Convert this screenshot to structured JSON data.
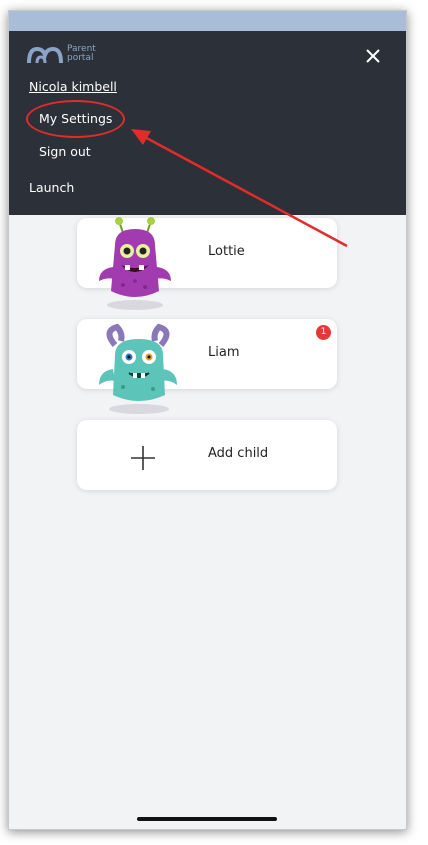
{
  "app": {
    "brand_line1": "Parent",
    "brand_line2": "portal"
  },
  "menu": {
    "user_name": "Nicola kimbell",
    "items": [
      {
        "label": "My Settings"
      },
      {
        "label": "Sign out"
      }
    ],
    "launch_label": "Launch"
  },
  "children": [
    {
      "name": "Lottie",
      "avatar_icon": "purple-monster-icon"
    },
    {
      "name": "Liam",
      "avatar_icon": "teal-monster-icon",
      "badge": "1"
    }
  ],
  "add_child_label": "Add child",
  "colors": {
    "menu_bg": "#2c3038",
    "page_bg": "#f2f3f5",
    "accent_red": "#e22b2b",
    "badge_red": "#e53935"
  }
}
